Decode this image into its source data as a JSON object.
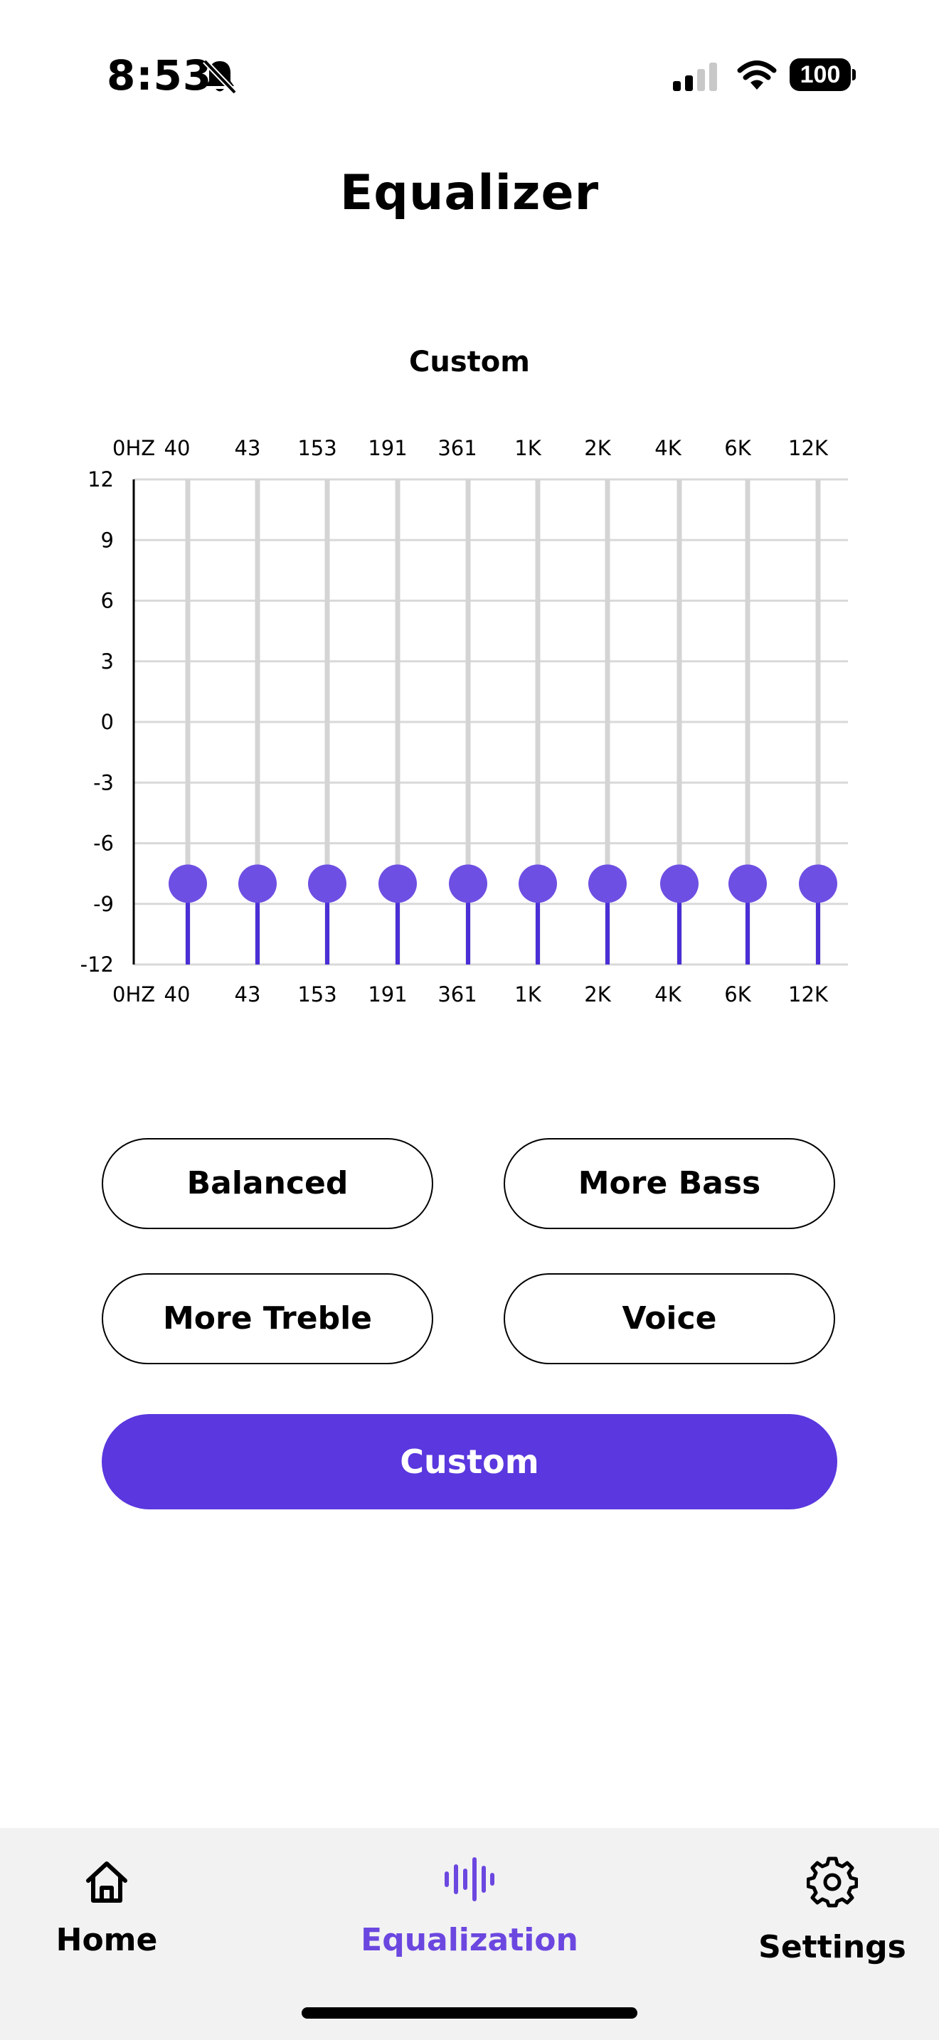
{
  "status_bar": {
    "time": "8:53",
    "battery": "100",
    "icons": [
      "bell-slash-icon",
      "cellular-signal-icon",
      "wifi-icon",
      "battery-icon"
    ]
  },
  "header": {
    "title": "Equalizer"
  },
  "equalizer": {
    "preset_caption": "Custom",
    "chart_data": {
      "type": "bar",
      "axis_origin_label": "0HZ",
      "categories": [
        "40",
        "43",
        "153",
        "191",
        "361",
        "1K",
        "2K",
        "4K",
        "6K",
        "12K"
      ],
      "values": [
        -8,
        -8,
        -8,
        -8,
        -8,
        -8,
        -8,
        -8,
        -8,
        -8
      ],
      "yticks": [
        12,
        9,
        6,
        3,
        0,
        -3,
        -6,
        -9,
        -12
      ],
      "ylim": [
        -12,
        12
      ],
      "grid": true,
      "colors": {
        "track": "#d4d4d4",
        "fill": "#4a2fd6",
        "knob": "#6e4fe3",
        "grid": "#d9d9d9"
      }
    }
  },
  "presets": {
    "balanced": "Balanced",
    "more_bass": "More Bass",
    "more_treble": "More Treble",
    "voice": "Voice",
    "custom": "Custom"
  },
  "bottom_nav": {
    "home": "Home",
    "equalization": "Equalization",
    "settings": "Settings",
    "active": "equalization",
    "active_color": "#6b47e0"
  }
}
